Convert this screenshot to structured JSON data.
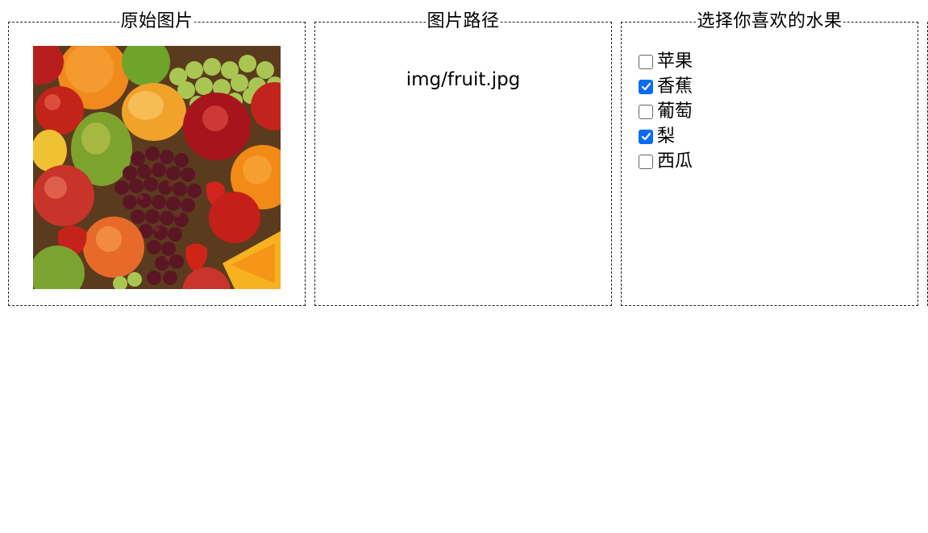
{
  "panels": {
    "original": {
      "title": "原始图片"
    },
    "path": {
      "title": "图片路径",
      "value": "img/fruit.jpg"
    },
    "choose": {
      "title": "选择你喜欢的水果",
      "options": [
        {
          "label": "苹果",
          "checked": false
        },
        {
          "label": "香蕉",
          "checked": true
        },
        {
          "label": "葡萄",
          "checked": false
        },
        {
          "label": "梨",
          "checked": true
        },
        {
          "label": "西瓜",
          "checked": false
        }
      ]
    }
  },
  "colors": {
    "checkbox_checked": "#0a6cf5",
    "border": "#222222"
  },
  "icons": {
    "fruit_image": "fruit-photo-icon",
    "check": "checkmark-icon"
  }
}
